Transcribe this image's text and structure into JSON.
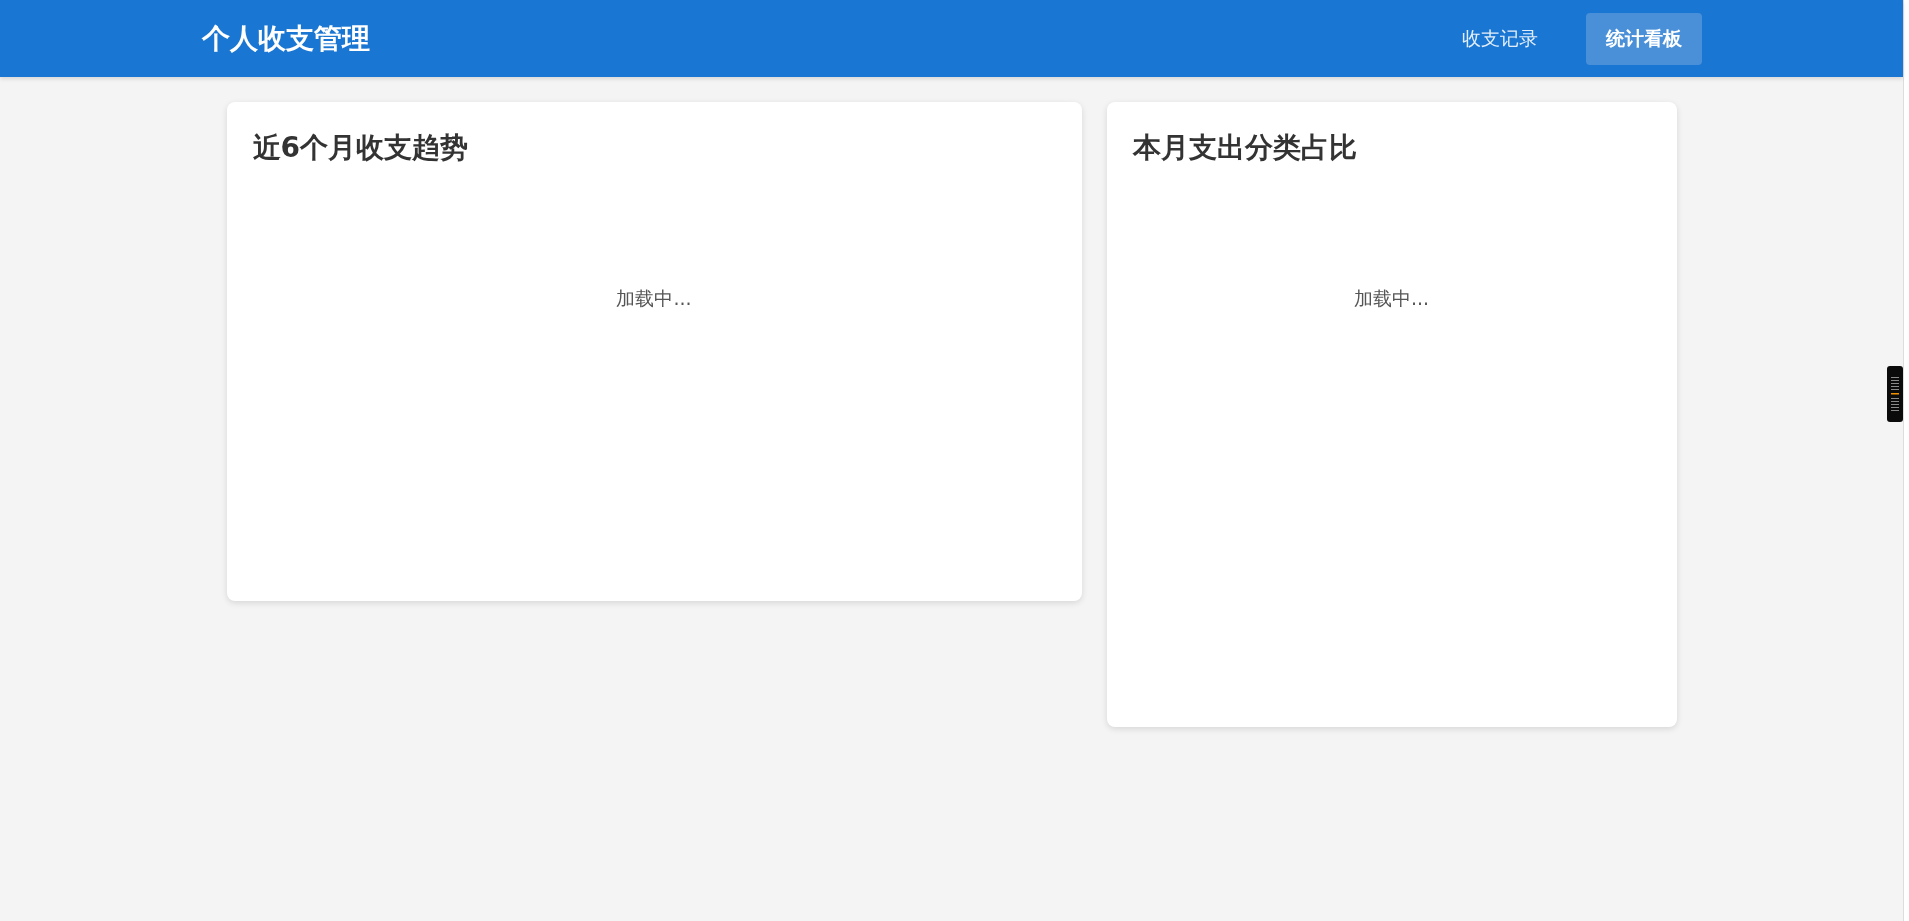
{
  "header": {
    "title": "个人收支管理",
    "nav": [
      {
        "label": "收支记录",
        "selected": false
      },
      {
        "label": "统计看板",
        "selected": true
      }
    ]
  },
  "panels": [
    {
      "title": "近6个月收支趋势",
      "loading_text": "加载中..."
    },
    {
      "title": "本月支出分类占比",
      "loading_text": "加载中..."
    }
  ]
}
